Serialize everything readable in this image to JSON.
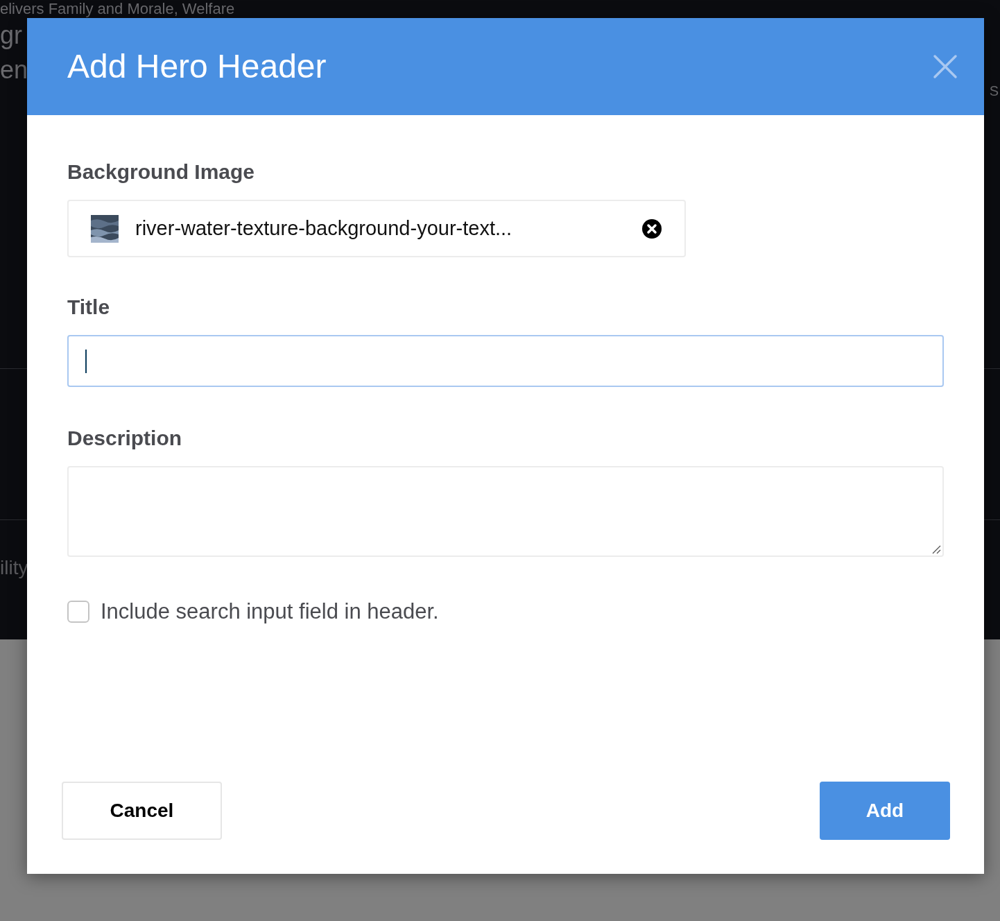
{
  "background_page": {
    "heading_fragments": [
      "elivers Family and Morale, Welfare",
      "gr",
      "en"
    ],
    "side_fragment": "S",
    "lower_fragment": "ility"
  },
  "dialog": {
    "title": "Add Hero Header",
    "background_image": {
      "label": "Background Image",
      "file_name": "river-water-texture-background-your-text..."
    },
    "title_field": {
      "label": "Title",
      "focused": true
    },
    "description_field": {
      "label": "Description"
    },
    "search_option": {
      "label": "Include search input field in header.",
      "checked": false
    },
    "buttons": [
      {
        "label": "Cancel",
        "kind": "secondary"
      },
      {
        "label": "Add",
        "kind": "primary"
      }
    ]
  }
}
